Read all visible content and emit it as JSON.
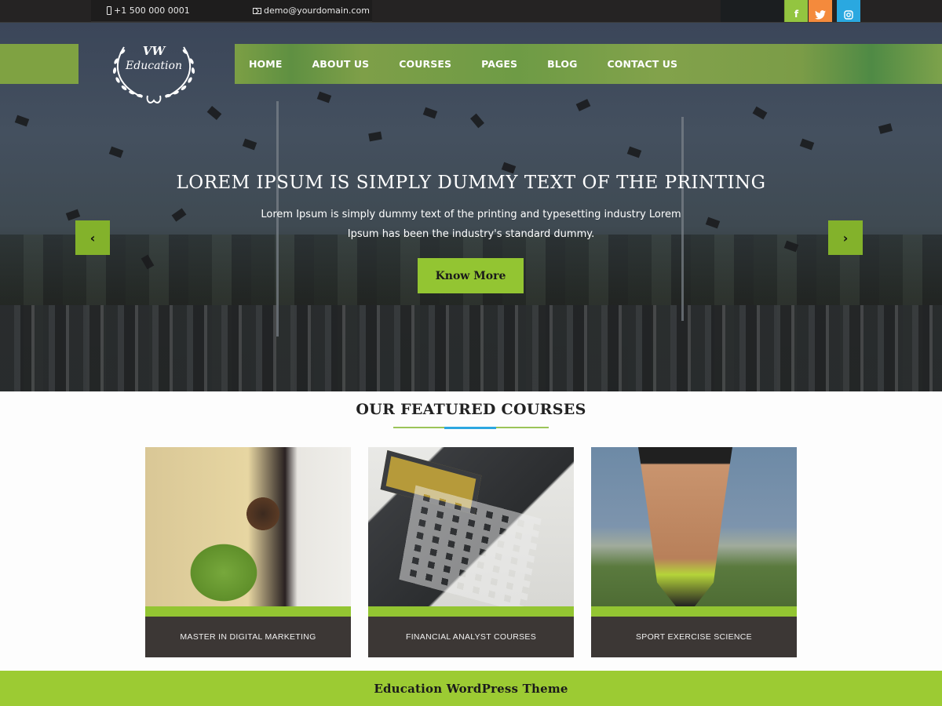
{
  "topbar": {
    "phone": "+1 500 000 0001",
    "email": "demo@yourdomain.com",
    "phone_icon": "mobile-phone-icon",
    "email_icon": "envelope-icon",
    "social": [
      {
        "name": "facebook",
        "glyph": "f",
        "color": "#93c540"
      },
      {
        "name": "twitter",
        "glyph": "🐦",
        "color": "#f48a3c"
      },
      {
        "name": "instagram",
        "glyph": "◎",
        "color": "#2aa8e0"
      }
    ]
  },
  "logo": {
    "line1": "VW",
    "line2": "Education"
  },
  "nav": {
    "items": [
      "HOME",
      "ABOUT US",
      "COURSES",
      "PAGES",
      "BLOG",
      "CONTACT US"
    ]
  },
  "hero": {
    "title": "LOREM IPSUM IS SIMPLY DUMMY TEXT OF THE PRINTING",
    "text": "Lorem Ipsum is simply dummy text of the printing and typesetting industry Lorem Ipsum has been the industry's standard dummy.",
    "button": "Know More",
    "prev_arrow": "‹",
    "next_arrow": "›"
  },
  "courses": {
    "heading": "OUR FEATURED COURSES",
    "items": [
      {
        "title": "MASTER IN DIGITAL MARKETING"
      },
      {
        "title": "FINANCIAL ANALYST COURSES"
      },
      {
        "title": "SPORT EXERCISE SCIENCE"
      }
    ]
  },
  "footer": {
    "text": "Education WordPress Theme"
  },
  "colors": {
    "accent_green": "#93c532",
    "accent_blue": "#2ca7e0",
    "footer_green": "#9ccb33",
    "topbar_bg": "#252323"
  }
}
